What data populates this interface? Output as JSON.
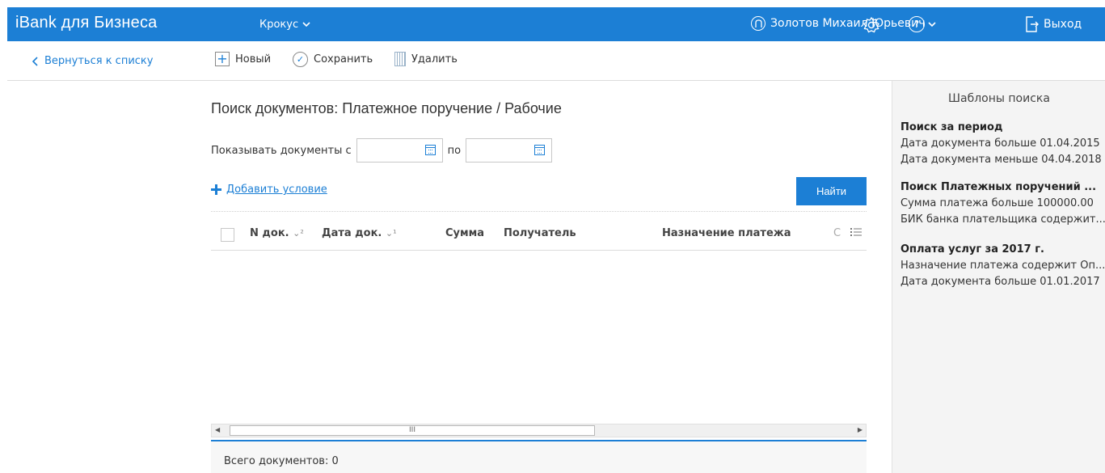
{
  "app": {
    "brand": "iBank для Бизнеса",
    "org": "Крокус",
    "user": "Золотов Михаил Юрьевич",
    "logout": "Выход"
  },
  "toolbar": {
    "back": "Вернуться к списку",
    "new": "Новый",
    "save": "Сохранить",
    "delete": "Удалить"
  },
  "main": {
    "title": "Поиск документов: Платежное поручение / Рабочие",
    "show_from": "Показывать документы с",
    "date_from": "",
    "to": "по",
    "date_to": "",
    "add_condition": "Добавить условие",
    "find": "Найти",
    "total": "Всего документов: 0"
  },
  "table": {
    "columns": [
      {
        "label": "N док.",
        "sort": "⌄²"
      },
      {
        "label": "Дата док.",
        "sort": "⌄¹"
      },
      {
        "label": "Сумма"
      },
      {
        "label": "Получатель"
      },
      {
        "label": "Назначение платежа"
      },
      {
        "label": "С"
      }
    ],
    "scroll_label": "III"
  },
  "templates": {
    "title": "Шаблоны поиска",
    "items": [
      {
        "name": "Поиск за период",
        "lines": [
          "Дата документа больше 01.04.2015",
          "Дата документа меньше 04.04.2018"
        ]
      },
      {
        "name": "Поиск Платежных поручений ...",
        "lines": [
          "Сумма платежа больше 100000.00",
          "БИК банка плательщика содержит..."
        ]
      },
      {
        "name": "Оплата услуг за 2017 г.",
        "lines": [
          "Назначение платежа содержит Оп...",
          "Дата документа больше 01.01.2017"
        ]
      }
    ]
  },
  "colors": {
    "accent": "#1c7fd5"
  },
  "icons": [
    "user-circle-icon",
    "gear-icon",
    "help-icon",
    "logout-icon",
    "chevron-left-icon",
    "new-icon",
    "save-icon",
    "delete-icon",
    "calendar-icon",
    "plus-icon",
    "column-menu-icon"
  ]
}
